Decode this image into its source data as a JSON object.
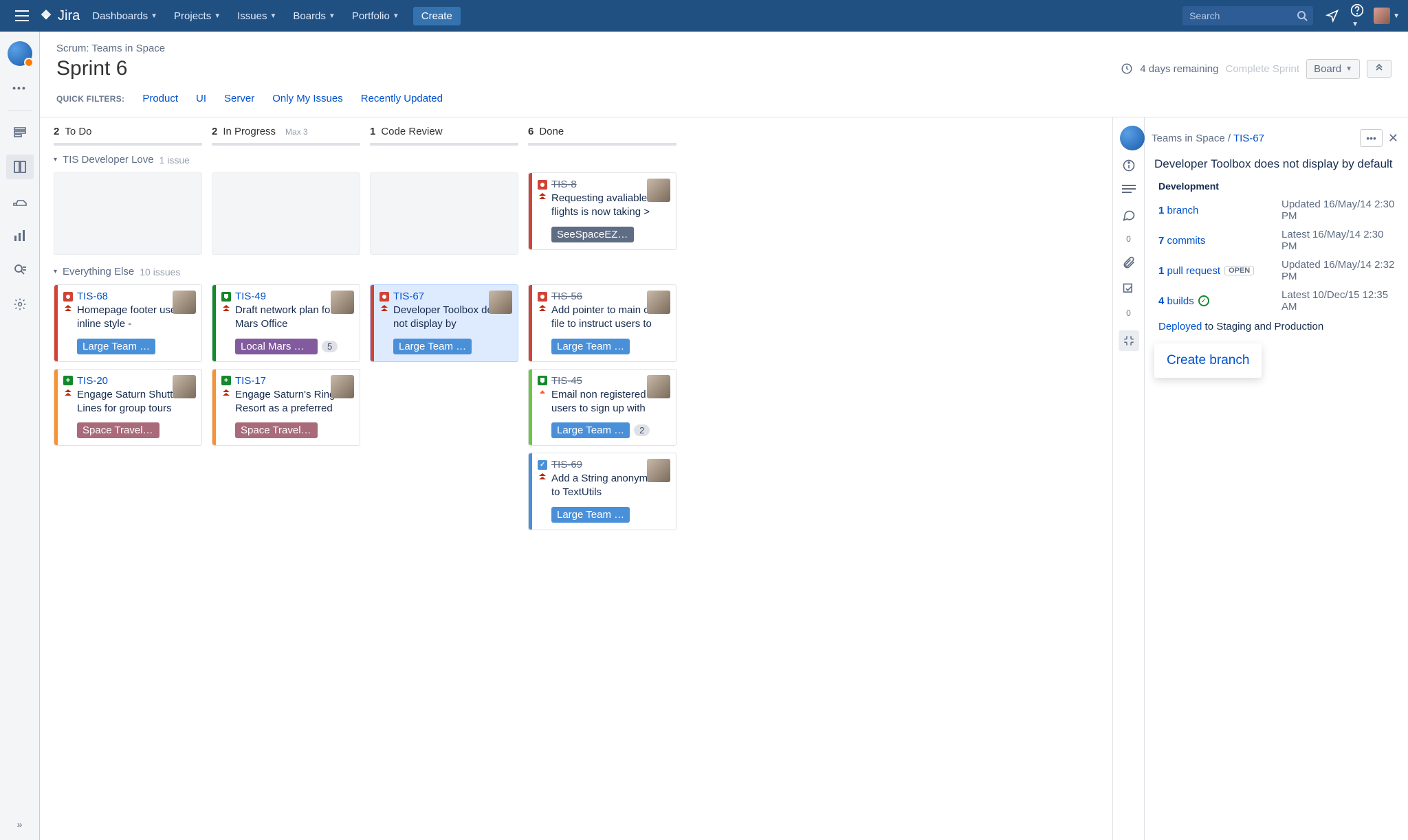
{
  "topnav": {
    "logo_text": "Jira",
    "menu": [
      "Dashboards",
      "Projects",
      "Issues",
      "Boards",
      "Portfolio"
    ],
    "create": "Create",
    "search_placeholder": "Search"
  },
  "breadcrumb": "Scrum: Teams in Space",
  "page_title": "Sprint 6",
  "header": {
    "remaining": "4 days remaining",
    "complete": "Complete Sprint",
    "board_btn": "Board"
  },
  "quickfilters": {
    "label": "QUICK FILTERS:",
    "items": [
      "Product",
      "UI",
      "Server",
      "Only My Issues",
      "Recently Updated"
    ]
  },
  "columns": [
    {
      "count": "2",
      "name": "To Do",
      "sub": ""
    },
    {
      "count": "2",
      "name": "In Progress",
      "sub": "Max 3"
    },
    {
      "count": "1",
      "name": "Code Review",
      "sub": ""
    },
    {
      "count": "6",
      "name": "Done",
      "sub": ""
    }
  ],
  "lanes": {
    "lane1": {
      "title": "TIS Developer Love",
      "count": "1 issue"
    },
    "lane2": {
      "title": "Everything Else",
      "count": "10 issues"
    }
  },
  "cards": {
    "tis8": {
      "key": "TIS-8",
      "sum": "Requesting avaliable flights is now taking >",
      "tag": "SeeSpaceEZ …"
    },
    "tis68": {
      "key": "TIS-68",
      "sum": "Homepage footer uses an inline style -",
      "tag": "Large Team …"
    },
    "tis49": {
      "key": "TIS-49",
      "sum": "Draft network plan for Mars Office",
      "tag": "Local Mars O…",
      "badge": "5"
    },
    "tis67": {
      "key": "TIS-67",
      "sum": "Developer Toolbox does not display by",
      "tag": "Large Team …"
    },
    "tis56": {
      "key": "TIS-56",
      "sum": "Add pointer to main css file to instruct users to",
      "tag": "Large Team …"
    },
    "tis20": {
      "key": "TIS-20",
      "sum": "Engage Saturn Shuttle Lines for group tours",
      "tag": "Space Travel …"
    },
    "tis17": {
      "key": "TIS-17",
      "sum": "Engage Saturn's Rings Resort as a preferred",
      "tag": "Space Travel …"
    },
    "tis45": {
      "key": "TIS-45",
      "sum": "Email non registered users to sign up with",
      "tag": "Large Team …",
      "badge": "2"
    },
    "tis69": {
      "key": "TIS-69",
      "sum": "Add a String anonymizer to TextUtils",
      "tag": "Large Team …"
    }
  },
  "detail": {
    "project": "Teams in Space",
    "sep": " / ",
    "key": "TIS-67",
    "title": "Developer Toolbox does not display by default",
    "section": "Development",
    "rows": {
      "branch": {
        "n": "1",
        "t": "branch",
        "r": "Updated 16/May/14 2:30 PM"
      },
      "commits": {
        "n": "7",
        "t": "commits",
        "r": "Latest 16/May/14 2:30 PM"
      },
      "pr": {
        "n": "1",
        "t": "pull request",
        "status": "OPEN",
        "r": "Updated 16/May/14 2:32 PM"
      },
      "builds": {
        "n": "4",
        "t": "builds",
        "r": "Latest 10/Dec/15 12:35 AM"
      }
    },
    "deployed_label": "Deployed",
    "deployed_text": " to Staging and Production",
    "create_branch": "Create branch",
    "rail_zero": "0"
  }
}
